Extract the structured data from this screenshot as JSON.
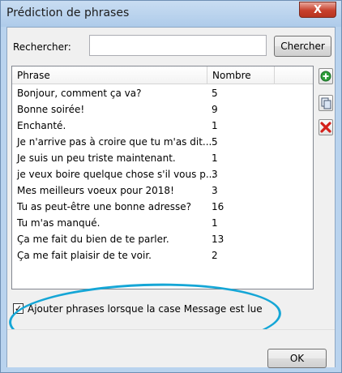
{
  "window": {
    "title": "Prédiction de phrases",
    "close_label": "X"
  },
  "search": {
    "label": "Rechercher:",
    "value": "",
    "placeholder": "",
    "button_label": "Chercher"
  },
  "table": {
    "columns": [
      "Phrase",
      "Nombre"
    ],
    "rows": [
      {
        "phrase": "Bonjour, comment ça va?",
        "count": "5"
      },
      {
        "phrase": "Bonne soirée!",
        "count": "9"
      },
      {
        "phrase": "Enchanté.",
        "count": "1"
      },
      {
        "phrase": "Je n'arrive pas à croire que tu m'as dit...",
        "count": "5"
      },
      {
        "phrase": "Je suis un peu triste maintenant.",
        "count": "1"
      },
      {
        "phrase": "je veux boire quelque chose s'il vous p...",
        "count": "3"
      },
      {
        "phrase": "Mes meilleurs voeux pour 2018!",
        "count": "3"
      },
      {
        "phrase": "Tu as peut-être une bonne adresse?",
        "count": "16"
      },
      {
        "phrase": "Tu m'as manqué.",
        "count": "1"
      },
      {
        "phrase": "Ça me fait du bien de te parler.",
        "count": "13"
      },
      {
        "phrase": "Ça me fait plaisir de te voir.",
        "count": "2"
      }
    ]
  },
  "side_actions": {
    "add_icon": "green-plus-icon",
    "copy_icon": "copy-icon",
    "delete_icon": "red-x-icon"
  },
  "option": {
    "checked": true,
    "check_mark": "✓",
    "label": "Ajouter phrases lorsque la case Message est lue"
  },
  "footer": {
    "ok_label": "OK"
  },
  "colors": {
    "highlight": "#15a6d6",
    "titlebar": "#b9d3ee",
    "close": "#c7402c"
  }
}
